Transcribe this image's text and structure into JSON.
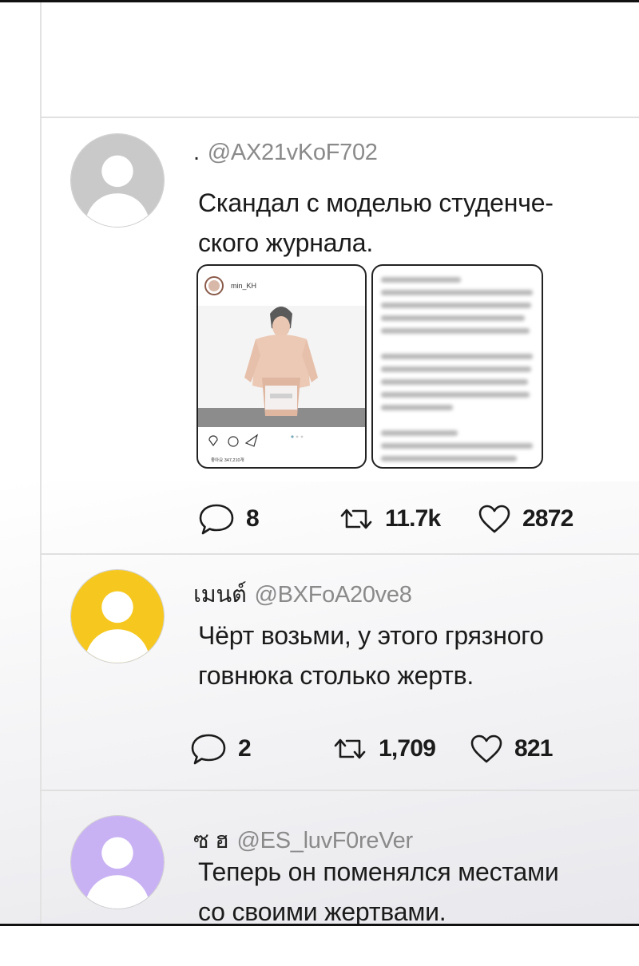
{
  "posts": [
    {
      "display_name": ".",
      "handle": "@AX21vKoF702",
      "text_lines": [
        "Скандал с моделью студенче-",
        "ского журнала."
      ],
      "avatar_color": "#c9c9c9",
      "media": {
        "left_image": {
          "username": "min_KH",
          "likes_text": "좋아요 347,210개"
        },
        "right_image": {
          "description": "blurred-text-screenshot"
        }
      },
      "stats": {
        "replies": "8",
        "retweets": "11.7k",
        "likes": "2872"
      }
    },
    {
      "display_name": "เมนต์",
      "handle": "@BXFoA20ve8",
      "text_lines": [
        "Чёрт возьми, у этого грязного",
        "говнюка столько жертв."
      ],
      "avatar_color": "#f6c81f",
      "stats": {
        "replies": "2",
        "retweets": "1,709",
        "likes": "821"
      }
    },
    {
      "display_name": "ซ ฮ",
      "handle": "@ES_luvF0reVer",
      "text_lines": [
        "Теперь он поменялся местами",
        "со своими жертвами."
      ],
      "avatar_color": "#c9b2f3"
    }
  ],
  "icons": {
    "reply": "speech-bubble-icon",
    "retweet": "retweet-icon",
    "like": "heart-icon",
    "avatar": "default-user-icon"
  },
  "colors": {
    "handle": "#8a8a8a",
    "text": "#1b1b1b",
    "divider": "#e0e0e0"
  }
}
